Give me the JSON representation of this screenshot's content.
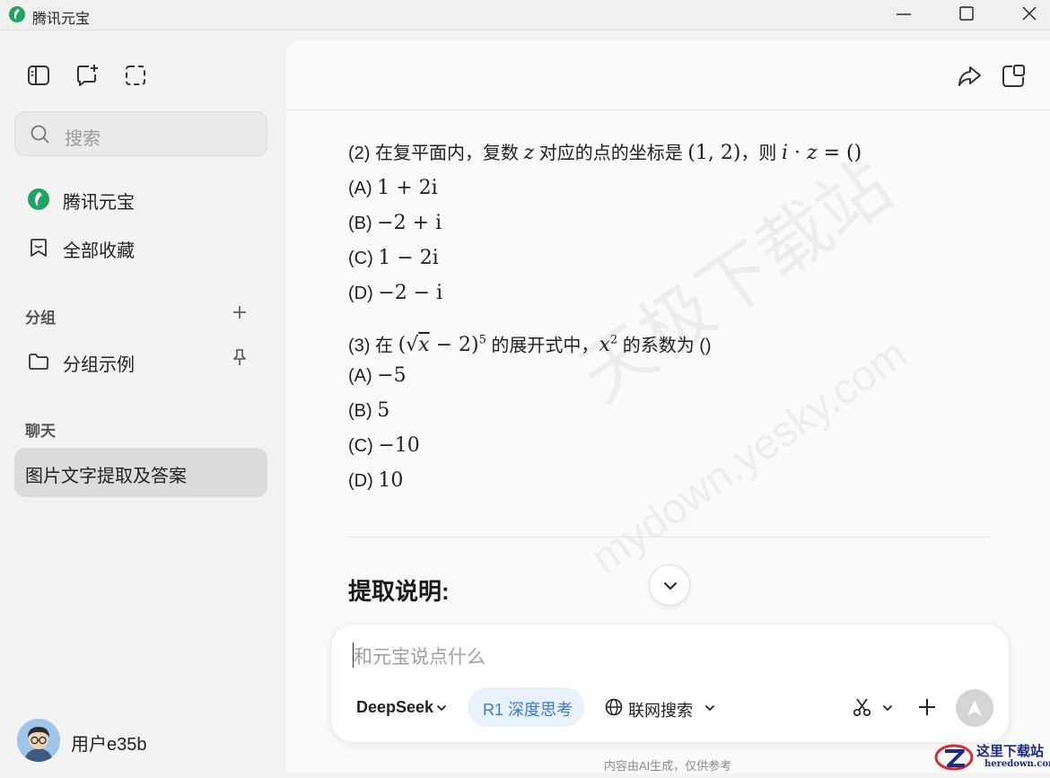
{
  "app": {
    "title": "腾讯元宝"
  },
  "sidebar": {
    "search_placeholder": "搜索",
    "nav": [
      {
        "label": "腾讯元宝",
        "icon": "yuanbao-logo-icon"
      },
      {
        "label": "全部收藏",
        "icon": "bookmark-icon"
      }
    ],
    "groups_title": "分组",
    "group_items": [
      {
        "label": "分组示例"
      }
    ],
    "chats_title": "聊天",
    "chats": [
      {
        "label": "图片文字提取及答案",
        "active": true
      }
    ],
    "user": {
      "name": "用户e35b"
    }
  },
  "content": {
    "q2": {
      "prefix": "(2) 在复平面内，复数 ",
      "mid1": " 对应的点的坐标是 ",
      "mid2": "，则 ",
      "options": [
        {
          "label": "(A)",
          "math": "1 + 2i"
        },
        {
          "label": "(B)",
          "math": "−2 + i"
        },
        {
          "label": "(C)",
          "math": "1 − 2i"
        },
        {
          "label": "(D)",
          "math": "−2 − i"
        }
      ]
    },
    "q3": {
      "prefix": "(3) 在 ",
      "mid1": " 的展开式中，",
      "mid2": " 的系数为 ()",
      "options": [
        {
          "label": "(A)",
          "math": "−5"
        },
        {
          "label": "(B)",
          "math": "5"
        },
        {
          "label": "(C)",
          "math": "−10"
        },
        {
          "label": "(D)",
          "math": "10"
        }
      ]
    },
    "extract_title": "提取说明:"
  },
  "composer": {
    "placeholder": "和元宝说点什么",
    "model": "DeepSeek",
    "deep_think": "R1 深度思考",
    "web_search": "联网搜索"
  },
  "footer": {
    "disclaimer": "内容由AI生成，仅供参考"
  },
  "watermark": {
    "cn": "天极下载站",
    "url": "mydown.yesky.com"
  },
  "corner_logo": {
    "cn": "这里下载站",
    "url": "heredown.com"
  },
  "colors": {
    "accent": "#3a7bd5",
    "logo_green": "#1fa463",
    "active_chat_bg": "#dcdcdc"
  }
}
